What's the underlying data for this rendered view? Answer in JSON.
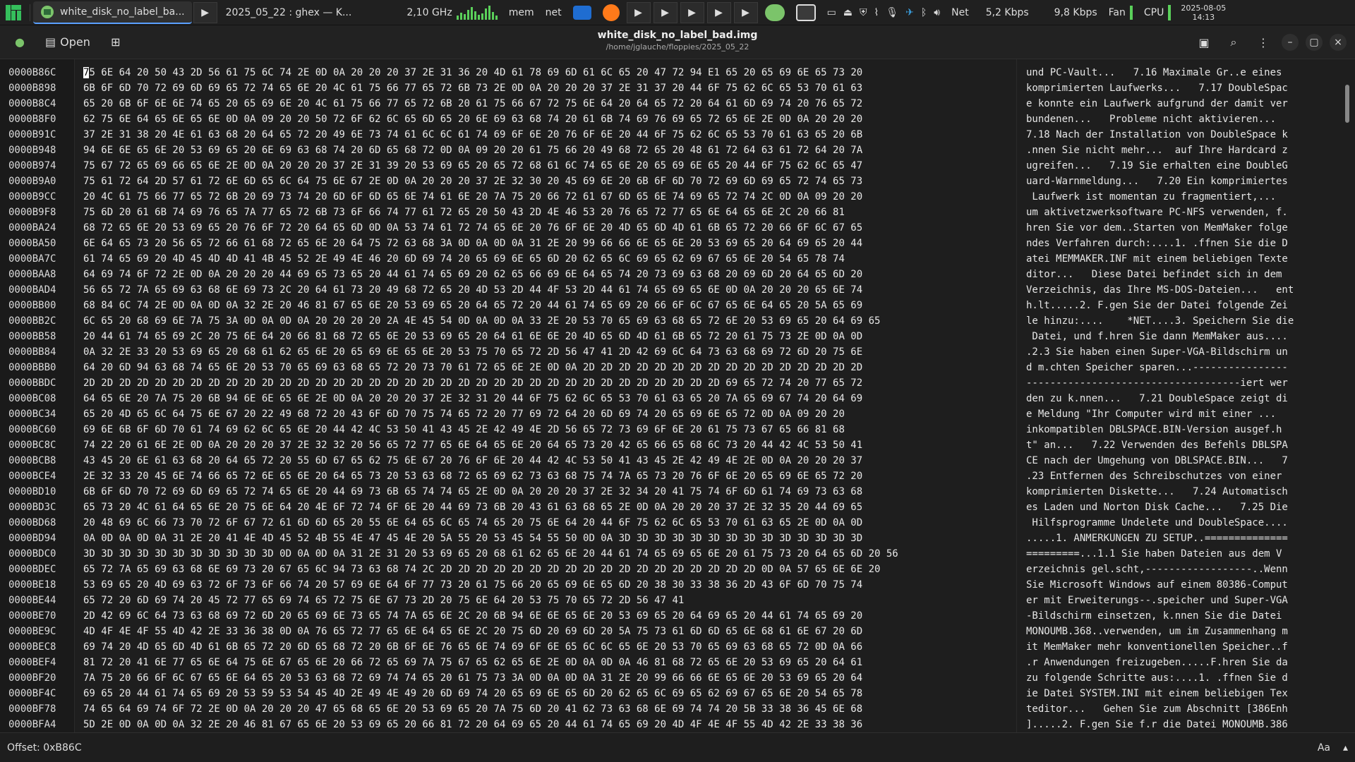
{
  "taskbar": {
    "window1_title": "white_disk_no_label_ba...",
    "window2_title": "2025_05_22 : ghex — K...",
    "cpu_freq": "2,10 GHz",
    "mem_label": "mem",
    "net_label": "net",
    "net_label2": "Net",
    "net_up": "5,2 Kbps",
    "net_down": "9,8 Kbps",
    "fan_label": "Fan",
    "cpu_label": "CPU",
    "date": "2025-08-05",
    "time": "14:13"
  },
  "header": {
    "open_label": "Open",
    "title": "white_disk_no_label_bad.img",
    "subtitle": "/home/jglauche/floppies/2025_05_22"
  },
  "offsets": [
    "0000B86C",
    "0000B898",
    "0000B8C4",
    "0000B8F0",
    "0000B91C",
    "0000B948",
    "0000B974",
    "0000B9A0",
    "0000B9CC",
    "0000B9F8",
    "0000BA24",
    "0000BA50",
    "0000BA7C",
    "0000BAA8",
    "0000BAD4",
    "0000BB00",
    "0000BB2C",
    "0000BB58",
    "0000BB84",
    "0000BBB0",
    "0000BBDC",
    "0000BC08",
    "0000BC34",
    "0000BC60",
    "0000BC8C",
    "0000BCB8",
    "0000BCE4",
    "0000BD10",
    "0000BD3C",
    "0000BD68",
    "0000BD94",
    "0000BDC0",
    "0000BDEC",
    "0000BE18",
    "0000BE44",
    "0000BE70",
    "0000BE9C",
    "0000BEC8",
    "0000BEF4",
    "0000BF20",
    "0000BF4C",
    "0000BF78",
    "0000BFA4"
  ],
  "hex_rows": [
    "75 6E 64 20 50 43 2D 56 61 75 6C 74 2E 0D 0A 20 20 20 37 2E 31 36 20 4D 61 78 69 6D 61 6C 65 20 47 72 94 E1 65 20 65 69 6E 65 73 20",
    "6B 6F 6D 70 72 69 6D 69 65 72 74 65 6E 20 4C 61 75 66 77 65 72 6B 73 2E 0D 0A 20 20 20 37 2E 31 37 20 44 6F 75 62 6C 65 53 70 61 63",
    "65 20 6B 6F 6E 6E 74 65 20 65 69 6E 20 4C 61 75 66 77 65 72 6B 20 61 75 66 67 72 75 6E 64 20 64 65 72 20 64 61 6D 69 74 20 76 65 72",
    "62 75 6E 64 65 6E 65 6E 0D 0A 09 20 20 50 72 6F 62 6C 65 6D 65 20 6E 69 63 68 74 20 61 6B 74 69 76 69 65 72 65 6E 2E 0D 0A 20 20 20",
    "37 2E 31 38 20 4E 61 63 68 20 64 65 72 20 49 6E 73 74 61 6C 6C 61 74 69 6F 6E 20 76 6F 6E 20 44 6F 75 62 6C 65 53 70 61 63 65 20 6B",
    "94 6E 6E 65 6E 20 53 69 65 20 6E 69 63 68 74 20 6D 65 68 72 0D 0A 09 20 20 61 75 66 20 49 68 72 65 20 48 61 72 64 63 61 72 64 20 7A",
    "75 67 72 65 69 66 65 6E 2E 0D 0A 20 20 20 37 2E 31 39 20 53 69 65 20 65 72 68 61 6C 74 65 6E 20 65 69 6E 65 20 44 6F 75 62 6C 65 47",
    "75 61 72 64 2D 57 61 72 6E 6D 65 6C 64 75 6E 67 2E 0D 0A 20 20 20 37 2E 32 30 20 45 69 6E 20 6B 6F 6D 70 72 69 6D 69 65 72 74 65 73",
    "20 4C 61 75 66 77 65 72 6B 20 69 73 74 20 6D 6F 6D 65 6E 74 61 6E 20 7A 75 20 66 72 61 67 6D 65 6E 74 69 65 72 74 2C 0D 0A 09 20 20",
    "75 6D 20 61 6B 74 69 76 65 7A 77 65 72 6B 73 6F 66 74 77 61 72 65 20 50 43 2D 4E 46 53 20 76 65 72 77 65 6E 64 65 6E 2C 20 66 81",
    "68 72 65 6E 20 53 69 65 20 76 6F 72 20 64 65 6D 0D 0A 53 74 61 72 74 65 6E 20 76 6F 6E 20 4D 65 6D 4D 61 6B 65 72 20 66 6F 6C 67 65",
    "6E 64 65 73 20 56 65 72 66 61 68 72 65 6E 20 64 75 72 63 68 3A 0D 0A 0D 0A 31 2E 20 99 66 66 6E 65 6E 20 53 69 65 20 64 69 65 20 44",
    "61 74 65 69 20 4D 45 4D 4D 41 4B 45 52 2E 49 4E 46 20 6D 69 74 20 65 69 6E 65 6D 20 62 65 6C 69 65 62 69 67 65 6E 20 54 65 78 74",
    "64 69 74 6F 72 2E 0D 0A 20 20 20 44 69 65 73 65 20 44 61 74 65 69 20 62 65 66 69 6E 64 65 74 20 73 69 63 68 20 69 6D 20 64 65 6D 20",
    "56 65 72 7A 65 69 63 68 6E 69 73 2C 20 64 61 73 20 49 68 72 65 20 4D 53 2D 44 4F 53 2D 44 61 74 65 69 65 6E 0D 0A 20 20 20 65 6E 74",
    "68 84 6C 74 2E 0D 0A 0D 0A 32 2E 20 46 81 67 65 6E 20 53 69 65 20 64 65 72 20 44 61 74 65 69 20 66 6F 6C 67 65 6E 64 65 20 5A 65 69",
    "6C 65 20 68 69 6E 7A 75 3A 0D 0A 0D 0A 20 20 20 20 2A 4E 45 54 0D 0A 0D 0A 33 2E 20 53 70 65 69 63 68 65 72 6E 20 53 69 65 20 64 69 65",
    "20 44 61 74 65 69 2C 20 75 6E 64 20 66 81 68 72 65 6E 20 53 69 65 20 64 61 6E 6E 20 4D 65 6D 4D 61 6B 65 72 20 61 75 73 2E 0D 0A 0D",
    "0A 32 2E 33 20 53 69 65 20 68 61 62 65 6E 20 65 69 6E 65 6E 20 53 75 70 65 72 2D 56 47 41 2D 42 69 6C 64 73 63 68 69 72 6D 20 75 6E",
    "64 20 6D 94 63 68 74 65 6E 20 53 70 65 69 63 68 65 72 20 73 70 61 72 65 6E 2E 0D 0A 2D 2D 2D 2D 2D 2D 2D 2D 2D 2D 2D 2D 2D 2D 2D 2D",
    "2D 2D 2D 2D 2D 2D 2D 2D 2D 2D 2D 2D 2D 2D 2D 2D 2D 2D 2D 2D 2D 2D 2D 2D 2D 2D 2D 2D 2D 2D 2D 2D 2D 2D 2D 2D 69 65 72 74 20 77 65 72",
    "64 65 6E 20 7A 75 20 6B 94 6E 6E 65 6E 2E 0D 0A 20 20 20 37 2E 32 31 20 44 6F 75 62 6C 65 53 70 61 63 65 20 7A 65 69 67 74 20 64 69",
    "65 20 4D 65 6C 64 75 6E 67 20 22 49 68 72 20 43 6F 6D 70 75 74 65 72 20 77 69 72 64 20 6D 69 74 20 65 69 6E 65 72 0D 0A 09 20 20",
    "69 6E 6B 6F 6D 70 61 74 69 62 6C 65 6E 20 44 42 4C 53 50 41 43 45 2E 42 49 4E 2D 56 65 72 73 69 6F 6E 20 61 75 73 67 65 66 81 68",
    "74 22 20 61 6E 2E 0D 0A 20 20 20 37 2E 32 32 20 56 65 72 77 65 6E 64 65 6E 20 64 65 73 20 42 65 66 65 68 6C 73 20 44 42 4C 53 50 41",
    "43 45 20 6E 61 63 68 20 64 65 72 20 55 6D 67 65 62 75 6E 67 20 76 6F 6E 20 44 42 4C 53 50 41 43 45 2E 42 49 4E 2E 0D 0A 20 20 20 37",
    "2E 32 33 20 45 6E 74 66 65 72 6E 65 6E 20 64 65 73 20 53 63 68 72 65 69 62 73 63 68 75 74 7A 65 73 20 76 6F 6E 20 65 69 6E 65 72 20",
    "6B 6F 6D 70 72 69 6D 69 65 72 74 65 6E 20 44 69 73 6B 65 74 74 65 2E 0D 0A 20 20 20 37 2E 32 34 20 41 75 74 6F 6D 61 74 69 73 63 68",
    "65 73 20 4C 61 64 65 6E 20 75 6E 64 20 4E 6F 72 74 6F 6E 20 44 69 73 6B 20 43 61 63 68 65 2E 0D 0A 20 20 20 37 2E 32 35 20 44 69 65",
    "20 48 69 6C 66 73 70 72 6F 67 72 61 6D 6D 65 20 55 6E 64 65 6C 65 74 65 20 75 6E 64 20 44 6F 75 62 6C 65 53 70 61 63 65 2E 0D 0A 0D",
    "0A 0D 0A 0D 0A 31 2E 20 41 4E 4D 45 52 4B 55 4E 47 45 4E 20 5A 55 20 53 45 54 55 50 0D 0A 3D 3D 3D 3D 3D 3D 3D 3D 3D 3D 3D 3D 3D 3D",
    "3D 3D 3D 3D 3D 3D 3D 3D 3D 3D 3D 0D 0A 0D 0A 31 2E 31 20 53 69 65 20 68 61 62 65 6E 20 44 61 74 65 69 65 6E 20 61 75 73 20 64 65 6D 20 56",
    "65 72 7A 65 69 63 68 6E 69 73 20 67 65 6C 94 73 63 68 74 2C 2D 2D 2D 2D 2D 2D 2D 2D 2D 2D 2D 2D 2D 2D 2D 2D 2D 2D 0D 0A 57 65 6E 6E 20",
    "53 69 65 20 4D 69 63 72 6F 73 6F 66 74 20 57 69 6E 64 6F 77 73 20 61 75 66 20 65 69 6E 65 6D 20 38 30 33 38 36 2D 43 6F 6D 70 75 74",
    "65 72 20 6D 69 74 20 45 72 77 65 69 74 65 72 75 6E 67 73 2D 20 75 6E 64 20 53 75 70 65 72 2D 56 47 41",
    "2D 42 69 6C 64 73 63 68 69 72 6D 20 65 69 6E 73 65 74 7A 65 6E 2C 20 6B 94 6E 6E 65 6E 20 53 69 65 20 64 69 65 20 44 61 74 65 69 20",
    "4D 4F 4E 4F 55 4D 42 2E 33 36 38 0D 0A 76 65 72 77 65 6E 64 65 6E 2C 20 75 6D 20 69 6D 20 5A 75 73 61 6D 6D 65 6E 68 61 6E 67 20 6D",
    "69 74 20 4D 65 6D 4D 61 6B 65 72 20 6D 65 68 72 20 6B 6F 6E 76 65 6E 74 69 6F 6E 65 6C 6C 65 6E 20 53 70 65 69 63 68 65 72 0D 0A 66",
    "81 72 20 41 6E 77 65 6E 64 75 6E 67 65 6E 20 66 72 65 69 7A 75 67 65 62 65 6E 2E 0D 0A 0D 0A 46 81 68 72 65 6E 20 53 69 65 20 64 61",
    "7A 75 20 66 6F 6C 67 65 6E 64 65 20 53 63 68 72 69 74 74 65 20 61 75 73 3A 0D 0A 0D 0A 31 2E 20 99 66 66 6E 65 6E 20 53 69 65 20 64",
    "69 65 20 44 61 74 65 69 20 53 59 53 54 45 4D 2E 49 4E 49 20 6D 69 74 20 65 69 6E 65 6D 20 62 65 6C 69 65 62 69 67 65 6E 20 54 65 78",
    "74 65 64 69 74 6F 72 2E 0D 0A 20 20 20 47 65 68 65 6E 20 53 69 65 20 7A 75 6D 20 41 62 73 63 68 6E 69 74 74 20 5B 33 38 36 45 6E 68",
    "5D 2E 0D 0A 0D 0A 32 2E 20 46 81 67 65 6E 20 53 69 65 20 66 81 72 20 64 69 65 20 44 61 74 65 69 20 4D 4F 4E 4F 55 4D 42 2E 33 38 36"
  ],
  "ascii_rows": [
    "und PC-Vault...   7.16 Maximale Gr..e eines",
    "komprimierten Laufwerks...   7.17 DoubleSpac",
    "e konnte ein Laufwerk aufgrund der damit ver",
    "bundenen...   Probleme nicht aktivieren...",
    "7.18 Nach der Installation von DoubleSpace k",
    ".nnen Sie nicht mehr...  auf Ihre Hardcard z",
    "ugreifen...   7.19 Sie erhalten eine DoubleG",
    "uard-Warnmeldung...   7.20 Ein komprimiertes",
    " Laufwerk ist momentan zu fragmentiert,...",
    "um aktivetzwerksoftware PC-NFS verwenden, f.",
    "hren Sie vor dem..Starten von MemMaker folge",
    "ndes Verfahren durch:....1. .ffnen Sie die D",
    "atei MEMMAKER.INF mit einem beliebigen Texte",
    "ditor...   Diese Datei befindet sich in dem",
    "Verzeichnis, das Ihre MS-DOS-Dateien...   ent",
    "h.lt.....2. F.gen Sie der Datei folgende Zei",
    "le hinzu:....    *NET....3. Speichern Sie die",
    " Datei, und f.hren Sie dann MemMaker aus....",
    ".2.3 Sie haben einen Super-VGA-Bildschirm un",
    "d m.chten Speicher sparen...----------------",
    "------------------------------------iert wer",
    "den zu k.nnen...   7.21 DoubleSpace zeigt di",
    "e Meldung \"Ihr Computer wird mit einer ...",
    "inkompatiblen DBLSPACE.BIN-Version ausgef.h",
    "t\" an...   7.22 Verwenden des Befehls DBLSPA",
    "CE nach der Umgehung von DBLSPACE.BIN...   7",
    ".23 Entfernen des Schreibschutzes von einer",
    "komprimierten Diskette...   7.24 Automatisch",
    "es Laden und Norton Disk Cache...   7.25 Die",
    " Hilfsprogramme Undelete und DoubleSpace....",
    ".....1. ANMERKUNGEN ZU SETUP..==============",
    "=========...1.1 Sie haben Dateien aus dem V",
    "erzeichnis gel.scht,------------------..Wenn",
    "Sie Microsoft Windows auf einem 80386-Comput",
    "er mit Erweiterungs--.speicher und Super-VGA",
    "-Bildschirm einsetzen, k.nnen Sie die Datei",
    "MONOUMB.368..verwenden, um im Zusammenhang m",
    "it MemMaker mehr konventionellen Speicher..f",
    ".r Anwendungen freizugeben.....F.hren Sie da",
    "zu folgende Schritte aus:....1. .ffnen Sie d",
    "ie Datei SYSTEM.INI mit einem beliebigen Tex",
    "teditor...   Gehen Sie zum Abschnitt [386Enh",
    "].....2. F.gen Sie f.r die Datei MONOUMB.386"
  ],
  "status": {
    "offset": "Offset: 0xB86C",
    "aa_label": "Aa"
  },
  "colors": {
    "accent": "#5aa0ff",
    "green": "#59d359",
    "bg": "#1e1e1e"
  }
}
